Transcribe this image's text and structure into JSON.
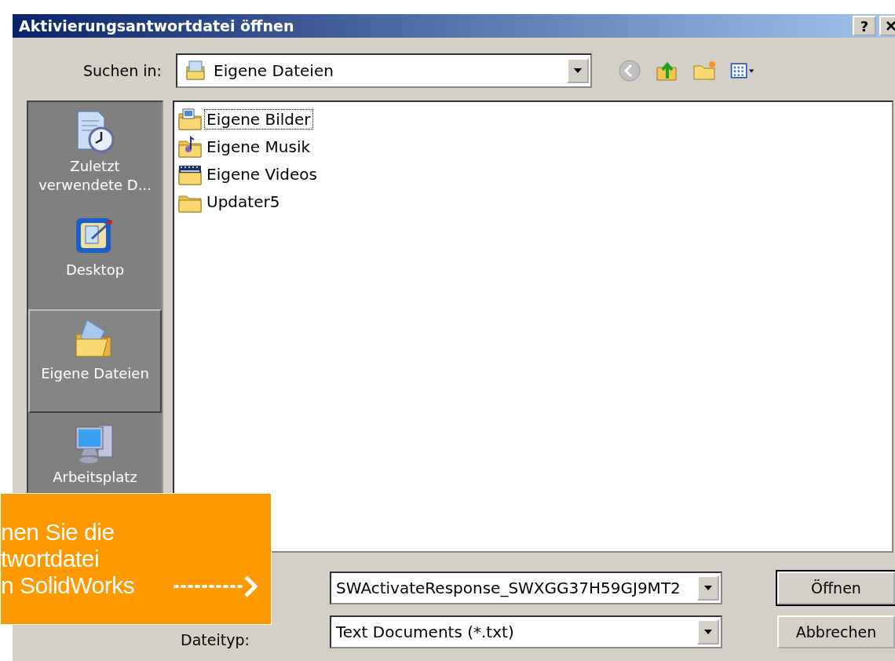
{
  "window": {
    "title": "Aktivierungsantwortdatei öffnen",
    "help_button": "?"
  },
  "look_in": {
    "label": "Suchen in:",
    "value": "Eigene Dateien"
  },
  "places": [
    {
      "kind": "recent",
      "label": "Zuletzt verwendete D...",
      "selected": false
    },
    {
      "kind": "desktop",
      "label": "Desktop",
      "selected": false
    },
    {
      "kind": "documents",
      "label": "Eigene Dateien",
      "selected": true
    },
    {
      "kind": "computer",
      "label": "Arbeitsplatz",
      "selected": false
    }
  ],
  "files": [
    {
      "kind": "pictures",
      "name": "Eigene Bilder",
      "selected": true
    },
    {
      "kind": "music",
      "name": "Eigene Musik",
      "selected": false
    },
    {
      "kind": "videos",
      "name": "Eigene Videos",
      "selected": false
    },
    {
      "kind": "folder",
      "name": "Updater5",
      "selected": false
    }
  ],
  "file_name": {
    "value": "SWActivateResponse_SWXGG37H59GJ9MT2"
  },
  "file_type": {
    "label": "Dateityp:",
    "value": "Text Documents (*.txt)"
  },
  "buttons": [
    {
      "label": "Öffnen",
      "default": true
    },
    {
      "label": "Abbrechen",
      "default": false
    }
  ],
  "callout": {
    "lines": [
      "nen Sie die",
      "twortdatei",
      "n SolidWorks"
    ]
  }
}
